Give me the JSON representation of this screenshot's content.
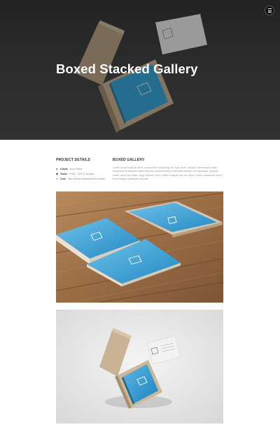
{
  "hero": {
    "title": "Boxed Stacked Gallery",
    "menu_icon": "hamburger-icon"
  },
  "project_details": {
    "heading": "PROJECT DETAILS",
    "rows": [
      {
        "icon": "user-icon",
        "label": "Client:",
        "value": "Jon's Place"
      },
      {
        "icon": "tag-icon",
        "label": "Tools:",
        "value": "HTML, CSS & JS/Ajax"
      },
      {
        "icon": "link-icon",
        "label": "Link:",
        "value": "http://demo.contentwriter.com/site"
      }
    ]
  },
  "gallery": {
    "heading": "BOXED GALLERY",
    "description": "Lorem ipsum dolor sit amet, consectetur adipiscing elit. Eget amet, volutpat, fermentum auctor mussaena fermentum fugiat damnes sollicitudinarum solliciudin facilisis sed egestasis. Aliquam lorem, apud sed efficie, duge lobortis. Nunc sollitto magnae dio nisi netus. Donec mesuticiar arnut? Duis feugiat constructiv laoreete."
  },
  "colors": {
    "accent_blue": "#2ea3d8",
    "wood": "#a07550",
    "hero_dark": "#333333"
  }
}
